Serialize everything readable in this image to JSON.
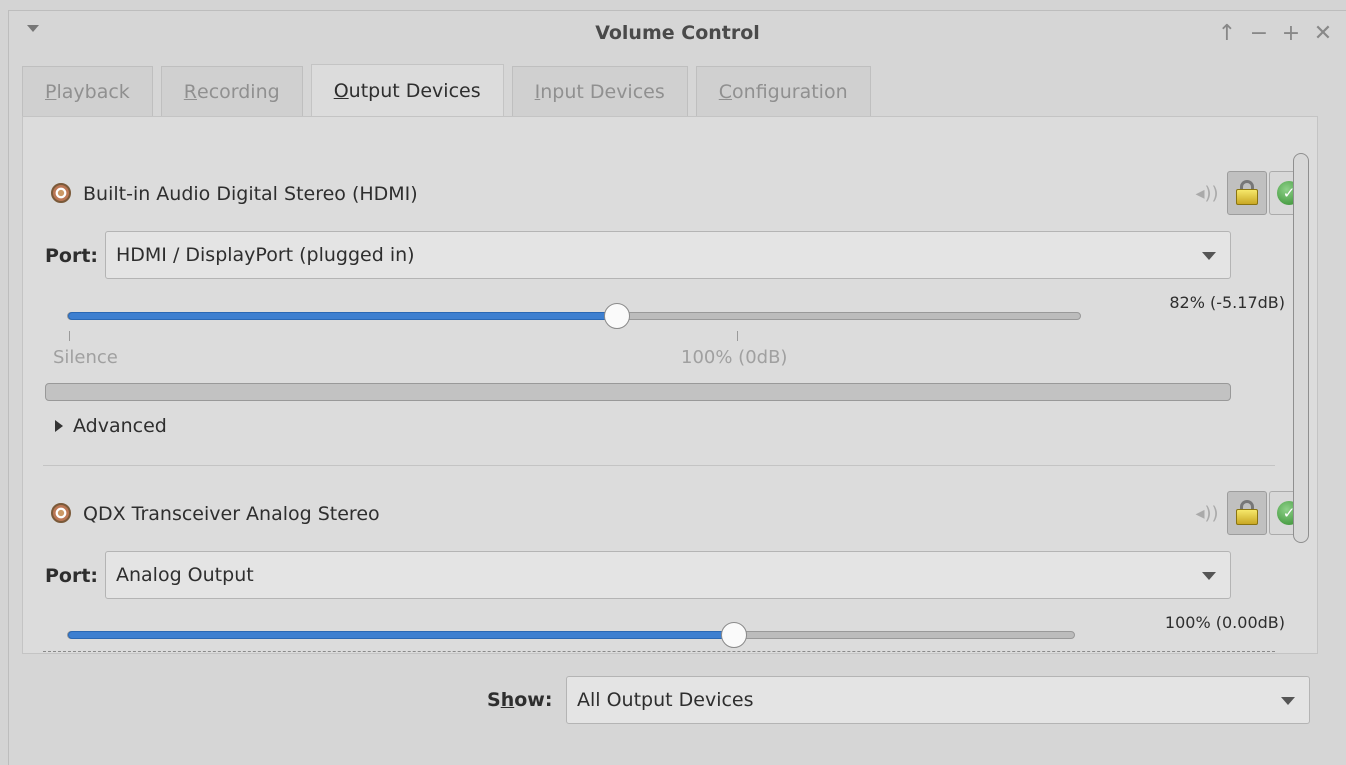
{
  "window": {
    "title": "Volume Control"
  },
  "titlebar_buttons": [
    "↑",
    "−",
    "+",
    "✕"
  ],
  "tabs": [
    {
      "label": "Playback",
      "mnemonic": "P",
      "rest": "layback",
      "active": false
    },
    {
      "label": "Recording",
      "mnemonic": "R",
      "rest": "ecording",
      "active": false
    },
    {
      "label": "Output Devices",
      "mnemonic": "O",
      "rest": "utput Devices",
      "active": true
    },
    {
      "label": "Input Devices",
      "mnemonic": "I",
      "rest": "nput Devices",
      "active": false
    },
    {
      "label": "Configuration",
      "mnemonic": "C",
      "rest": "onfiguration",
      "active": false
    }
  ],
  "devices": [
    {
      "name": "Built-in Audio Digital Stereo (HDMI)",
      "port_label": "Port:",
      "port_value": "HDMI / DisplayPort (plugged in)",
      "volume_text": "82% (-5.17dB)",
      "volume_fraction": 0.82,
      "scale_labels": {
        "silence": "Silence",
        "full": "100% (0dB)"
      },
      "advanced_label": "Advanced"
    },
    {
      "name": "QDX Transceiver Analog Stereo",
      "port_label": "Port:",
      "port_value": "Analog Output",
      "volume_text": "100% (0.00dB)",
      "volume_fraction": 1.0
    }
  ],
  "show": {
    "label_prefix": "S",
    "label_mnemonic": "h",
    "label_suffix": "ow:",
    "value": "All Output Devices"
  },
  "colors": {
    "slider_fill": "#3d7fd0",
    "default_check": "#2f8a2a",
    "lock": "#e8d34a"
  },
  "icons": {
    "volume": "speaker-icon",
    "lock": "lock-icon",
    "default": "check-icon",
    "device": "speaker-device-icon"
  }
}
